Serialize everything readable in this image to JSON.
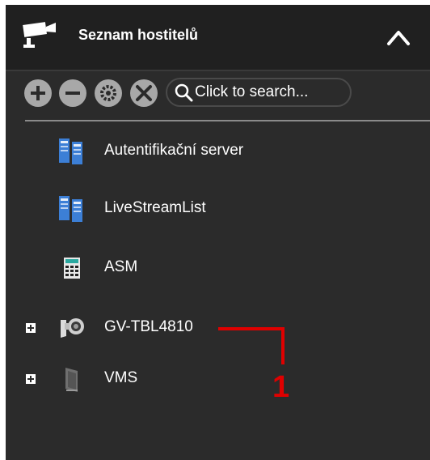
{
  "header": {
    "title": "Seznam hostitelů",
    "icon": "camera-icon",
    "collapse_icon": "chevron-up-icon"
  },
  "toolbar": {
    "buttons": [
      "add-icon",
      "remove-icon",
      "settings-icon",
      "tools-icon"
    ],
    "search_placeholder": "Click to search..."
  },
  "tree": [
    {
      "label": "Autentifikační server",
      "icon": "server-icon",
      "expandable": false
    },
    {
      "label": "LiveStreamList",
      "icon": "server-icon",
      "expandable": false
    },
    {
      "label": "ASM",
      "icon": "calculator-icon",
      "expandable": false
    },
    {
      "label": "GV-TBL4810",
      "icon": "ip-camera-icon",
      "expandable": true
    },
    {
      "label": "VMS",
      "icon": "vms-icon",
      "expandable": true
    }
  ],
  "annotation": {
    "label": "1",
    "color": "#e00000"
  }
}
